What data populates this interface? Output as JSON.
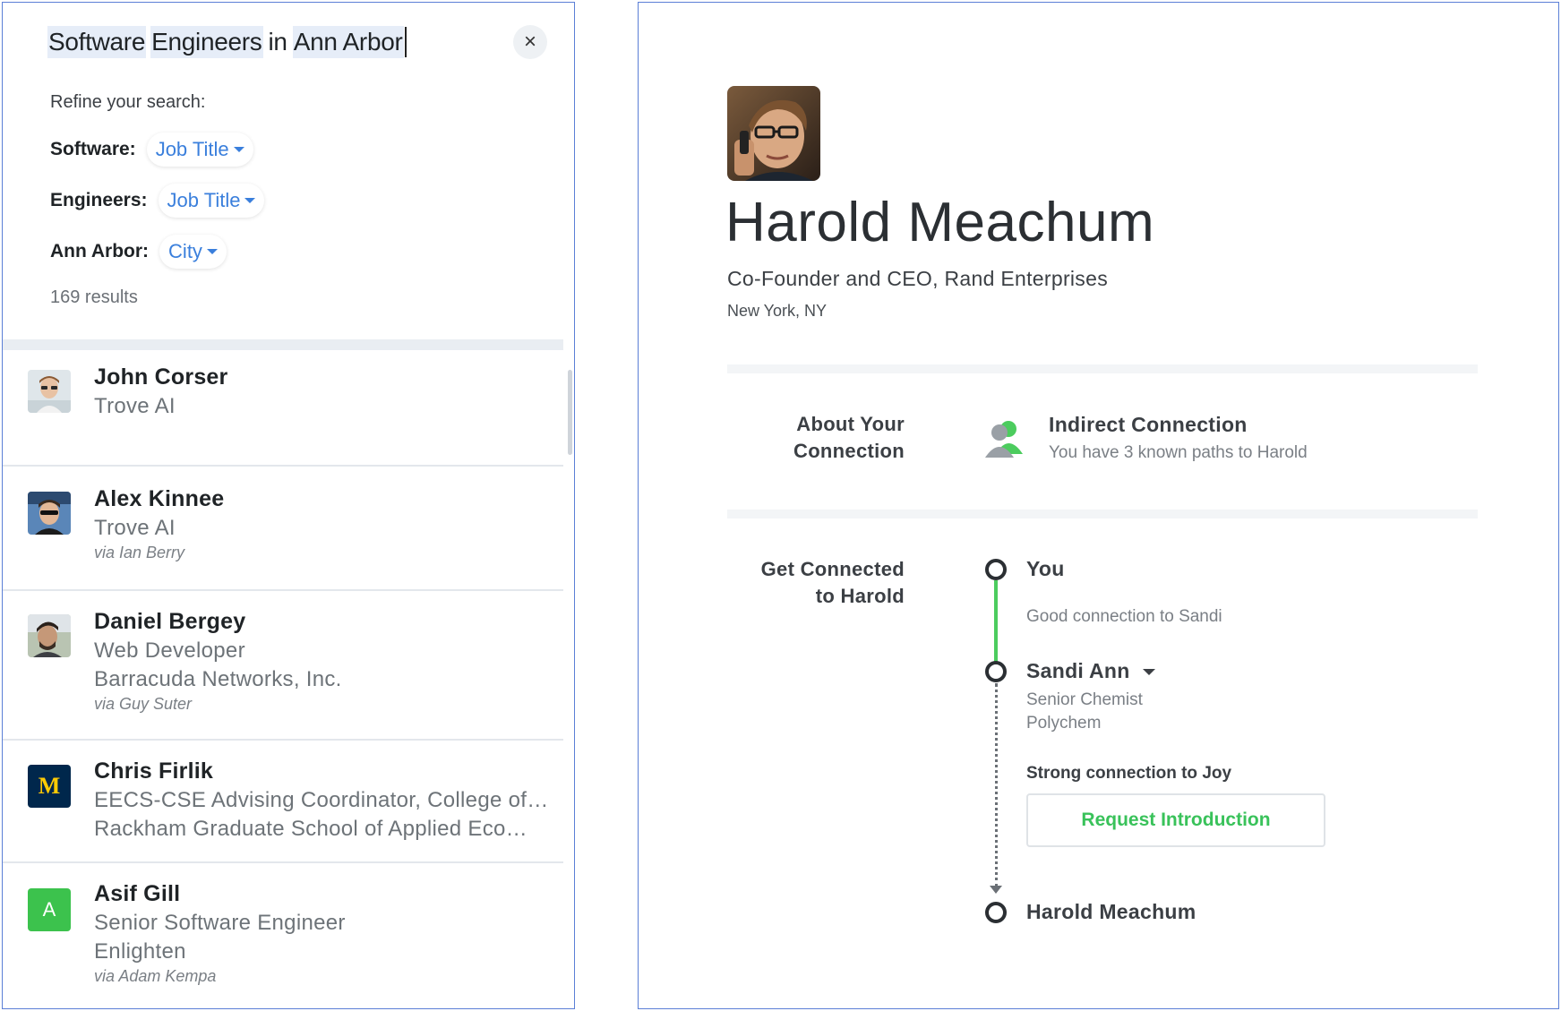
{
  "search": {
    "tokens": [
      {
        "text": "Software",
        "highlighted": true
      },
      {
        "text": "Engineers",
        "highlighted": true
      },
      {
        "text": "in",
        "highlighted": false
      },
      {
        "text": "Ann Arbor",
        "highlighted": true
      }
    ],
    "clear_icon": "×"
  },
  "refine": {
    "heading": "Refine your search:",
    "rows": [
      {
        "term": "Software:",
        "chip": "Job Title"
      },
      {
        "term": "Engineers:",
        "chip": "Job Title"
      },
      {
        "term": "Ann Arbor:",
        "chip": "City"
      }
    ],
    "results_count": "169 results"
  },
  "results": [
    {
      "name": "John Corser",
      "lines": [
        "Trove AI"
      ],
      "via": ""
    },
    {
      "name": "Alex Kinnee",
      "lines": [
        "Trove AI"
      ],
      "via": "via Ian Berry"
    },
    {
      "name": "Daniel Bergey",
      "lines": [
        "Web Developer",
        "Barracuda Networks, Inc."
      ],
      "via": "via Guy Suter"
    },
    {
      "name": "Chris Firlik",
      "lines": [
        "EECS-CSE Advising Coordinator, College of…",
        "Rackham Graduate School of Applied Eco…"
      ],
      "via": "",
      "avatar_text": "M"
    },
    {
      "name": "Asif Gill",
      "lines": [
        "Senior Software Engineer",
        "Enlighten"
      ],
      "via": "via Adam Kempa",
      "avatar_text": "A"
    }
  ],
  "profile": {
    "name": "Harold Meachum",
    "title": "Co-Founder and CEO, Rand Enterprises",
    "location": "New York, NY"
  },
  "about": {
    "label_line1": "About Your",
    "label_line2": "Connection",
    "type": "Indirect Connection",
    "paths": "You have 3 known paths to Harold"
  },
  "get_connected": {
    "label_line1": "Get Connected",
    "label_line2": "to Harold",
    "you": "You",
    "you_note": "Good connection to Sandi",
    "intermediary_name": "Sandi Ann",
    "intermediary_title": "Senior Chemist",
    "intermediary_company": "Polychem",
    "intermediary_note": "Strong connection to Joy",
    "request_button": "Request Introduction",
    "target": "Harold Meachum"
  },
  "colors": {
    "accent_blue": "#3a7fdc",
    "accent_green": "#39c25a",
    "panel_border": "#5b7fd6",
    "michigan_blue": "#00274c",
    "michigan_maize": "#ffcb05",
    "avatar_green": "#3cc24d"
  },
  "icons": {
    "clear": "close-icon",
    "chip_caret": "caret-down-icon",
    "connection": "indirect-connection-icon"
  }
}
